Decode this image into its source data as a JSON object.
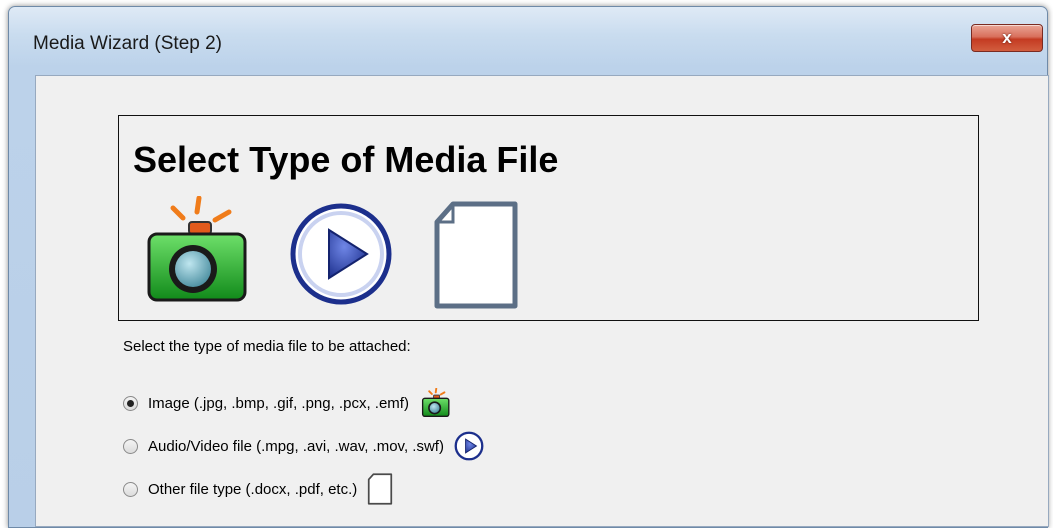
{
  "window": {
    "title": "Media Wizard (Step 2)",
    "close_label": "x"
  },
  "header": {
    "title": "Select Type of Media File",
    "icons": [
      "camera-icon",
      "play-icon",
      "document-icon"
    ]
  },
  "prompt": "Select the type of media file to be attached:",
  "options": [
    {
      "label": "Image (.jpg, .bmp, .gif, .png, .pcx, .emf)",
      "selected": true,
      "icon": "camera-icon"
    },
    {
      "label": "Audio/Video file (.mpg, .avi, .wav, .mov, .swf)",
      "selected": false,
      "icon": "play-icon"
    },
    {
      "label": "Other file type (.docx, .pdf, etc.)",
      "selected": false,
      "icon": "document-icon"
    }
  ],
  "colors": {
    "camera_body": "#22a827",
    "camera_flash": "#e8741c",
    "play_blue": "#2b3fa0",
    "close_red": "#c9432a"
  }
}
